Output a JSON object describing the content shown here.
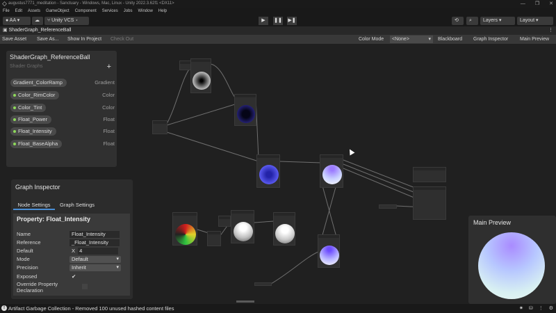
{
  "window": {
    "title": "augustus7771_meditation - Sanctuary - Windows, Mac, Linux - Unity 2022.3.62f1 <DX11>",
    "controls": [
      "—",
      "❐",
      "✕"
    ]
  },
  "menubar": [
    "File",
    "Edit",
    "Assets",
    "GameObject",
    "Component",
    "Services",
    "Jobs",
    "Window",
    "Help"
  ],
  "toolbar": {
    "account": "AA",
    "vcs": "Unity VCS",
    "play": "▶",
    "pause": "❚❚",
    "step": "▶❚",
    "layers": "Layers",
    "layout": "Layout"
  },
  "tab": {
    "title": "ShaderGraph_ReferenceBall"
  },
  "graph_toolbar": {
    "save_asset": "Save Asset",
    "save_as": "Save As...",
    "show_in_project": "Show In Project",
    "check_out": "Check Out",
    "color_mode_label": "Color Mode",
    "color_mode_value": "<None>",
    "blackboard": "Blackboard",
    "graph_inspector": "Graph Inspector",
    "main_preview": "Main Preview"
  },
  "blackboard": {
    "title": "ShaderGraph_ReferenceBall",
    "subtitle": "Shader Graphs",
    "add": "+",
    "properties": [
      {
        "name": "Gradient_ColorRamp",
        "type": "Gradient",
        "dot": false
      },
      {
        "name": "Color_RimColor",
        "type": "Color",
        "dot": true
      },
      {
        "name": "Color_Tint",
        "type": "Color",
        "dot": true
      },
      {
        "name": "Float_Power",
        "type": "Float",
        "dot": true
      },
      {
        "name": "Float_Intensity",
        "type": "Float",
        "dot": true
      },
      {
        "name": "Float_BaseAlpha",
        "type": "Float",
        "dot": true
      }
    ]
  },
  "inspector": {
    "title": "Graph Inspector",
    "tab_node": "Node Settings",
    "tab_graph": "Graph Settings",
    "property_header": "Property: Float_Intensity",
    "name_label": "Name",
    "name_value": "Float_Intensity",
    "reference_label": "Reference",
    "reference_value": "_Float_Intensity",
    "default_label": "Default",
    "default_x": "X",
    "default_value": "4",
    "mode_label": "Mode",
    "mode_value": "Default",
    "precision_label": "Precision",
    "precision_value": "Inherit",
    "exposed_label": "Exposed",
    "exposed_check": "✔",
    "override_label": "Override Property Declaration"
  },
  "main_preview": {
    "title": "Main Preview"
  },
  "status": {
    "message": "Artifact Garbage Collection - Removed 100 unused hashed content files",
    "warn": "!"
  }
}
